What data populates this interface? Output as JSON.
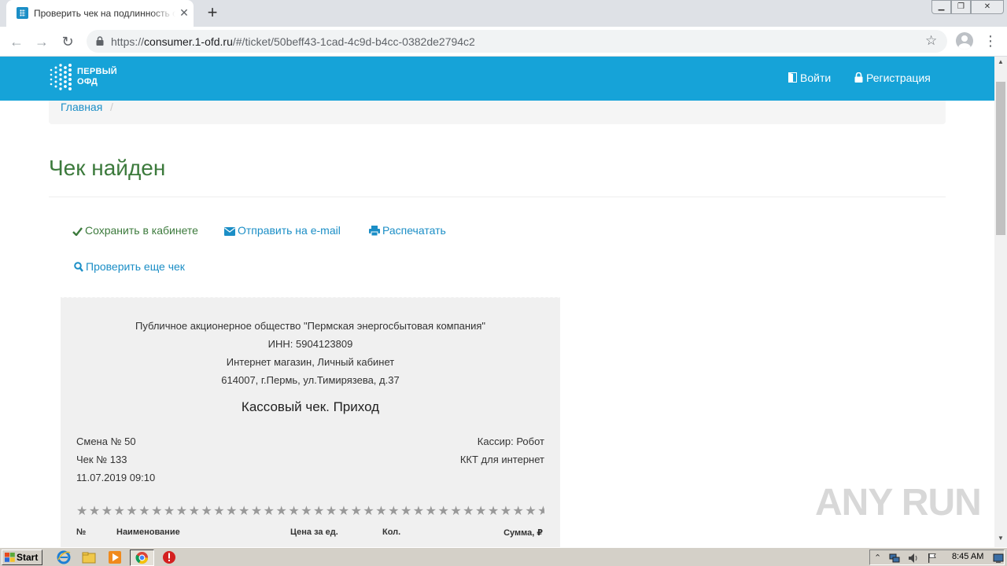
{
  "browser": {
    "tab_title": "Проверить чек на подлинность онлайн",
    "close_glyph": "✕",
    "new_tab_glyph": "+",
    "url_scheme": "https://",
    "url_host": "consumer.1-ofd.ru",
    "url_path": "/#/ticket/50beff43-1cad-4c9d-b4cc-0382de2794c2",
    "back_glyph": "←",
    "forward_glyph": "→",
    "reload_glyph": "↻",
    "star_glyph": "☆",
    "menu_glyph": "⋮",
    "window_minimize": "▁",
    "window_maximize": "❐",
    "window_close": "✕"
  },
  "header": {
    "logo_line1": "ПЕРВЫЙ",
    "logo_line2": "ОФД",
    "login_label": "Войти",
    "register_label": "Регистрация",
    "brand_color": "#16a3d8"
  },
  "breadcrumb": {
    "home": "Главная",
    "separator": "/"
  },
  "page": {
    "title": "Чек найден",
    "title_color": "#3c7a3c"
  },
  "actions": {
    "save": "Сохранить в кабинете",
    "email": "Отправить на e-mail",
    "print": "Распечатать",
    "check_another": "Проверить еще чек"
  },
  "receipt": {
    "seller_name": "Публичное акционерное общество \"Пермская энергосбытовая компания\"",
    "inn": "ИНН: 5904123809",
    "shop": "Интернет магазин, Личный кабинет",
    "address": "614007, г.Пермь, ул.Тимирязева, д.37",
    "type": "Кассовый чек. Приход",
    "shift": "Смена № 50",
    "check_number": "Чек № 133",
    "datetime": "11.07.2019 09:10",
    "cashier": "Кассир: Робот",
    "kkt": "ККТ для интернет",
    "separator": "★★★★★★★★★★★★★★★★★★★★★★★★★★★★★★★★★★★★★★★★★★★★★★★★★★★★★★★★★★★★★★★★★★★★★★★★",
    "columns": {
      "no": "№",
      "name": "Наименование",
      "price": "Цена за ед.",
      "qty": "Кол.",
      "sum": "Сумма, ₽"
    }
  },
  "watermark": "ANY RUN",
  "taskbar": {
    "start_label": "Start",
    "clock": "8:45 AM"
  }
}
